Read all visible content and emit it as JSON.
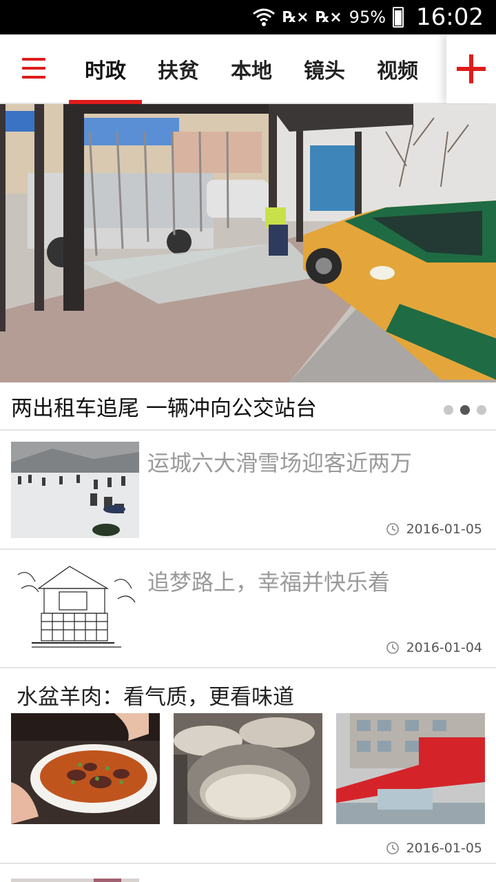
{
  "status_bar": {
    "sim1": "℞×",
    "sim2": "℞×",
    "battery": "95%",
    "time": "16:02"
  },
  "nav": {
    "tabs": [
      {
        "label": "时政",
        "active": true
      },
      {
        "label": "扶贫",
        "active": false
      },
      {
        "label": "本地",
        "active": false
      },
      {
        "label": "镜头",
        "active": false
      },
      {
        "label": "视频",
        "active": false
      }
    ],
    "accent_color": "#e01b1b"
  },
  "hero": {
    "caption": "两出租车追尾 一辆冲向公交站台",
    "page_count": 3,
    "active_index": 1
  },
  "news": [
    {
      "title": "运城六大滑雪场迎客近两万",
      "date": "2016-01-05"
    },
    {
      "title": "追梦路上，幸福并快乐着",
      "date": "2016-01-04"
    }
  ],
  "gallery": {
    "title": "水盆羊肉：看气质，更看味道",
    "date": "2016-01-05"
  }
}
